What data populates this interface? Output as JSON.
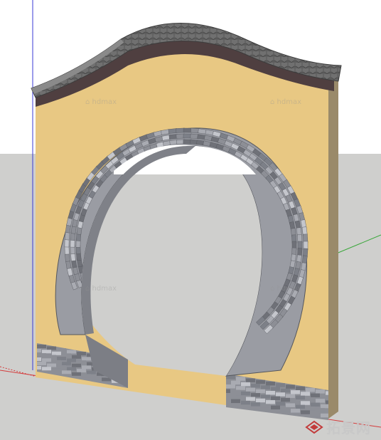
{
  "scene": {
    "sky_color": "#ffffff",
    "ground_color": "#cfcfcd",
    "wall_plaster_color": "#e8c883",
    "brick_colors": [
      "#8d8f96",
      "#a9abb2",
      "#6f7178",
      "#c4c6cc",
      "#7d8088"
    ],
    "tile_color": "#6e6e6e",
    "band_color": "#4f3f40",
    "axis_colors": {
      "red": "#d43a3a",
      "green": "#37a637",
      "blue": "#3a3ad4"
    }
  },
  "watermark": {
    "text": "拓景网",
    "logo_icon": "cube-logo-icon"
  }
}
